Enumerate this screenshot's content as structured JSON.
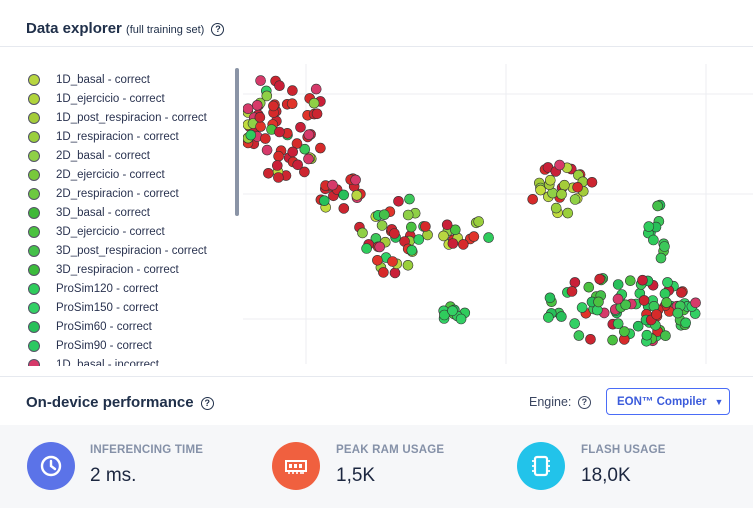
{
  "explorer": {
    "title": "Data explorer",
    "subtitle": "(full training set)",
    "legend": [
      {
        "label": "1D_basal - correct",
        "color": "#b8d641"
      },
      {
        "label": "1D_ejercicio - correct",
        "color": "#b0d43c"
      },
      {
        "label": "1D_post_respiracion - correct",
        "color": "#a4cc3a"
      },
      {
        "label": "1D_respiracion - correct",
        "color": "#9acf3c"
      },
      {
        "label": "2D_basal - correct",
        "color": "#8fd046"
      },
      {
        "label": "2D_ejercicio - correct",
        "color": "#78c83c"
      },
      {
        "label": "2D_respiracion - correct",
        "color": "#6dc840"
      },
      {
        "label": "3D_basal - correct",
        "color": "#3fb838"
      },
      {
        "label": "3D_ejercicio - correct",
        "color": "#4bc240"
      },
      {
        "label": "3D_post_respiracion - correct",
        "color": "#45c04a"
      },
      {
        "label": "3D_respiracion - correct",
        "color": "#3cbb3c"
      },
      {
        "label": "ProSim120 - correct",
        "color": "#2fcc5c"
      },
      {
        "label": "ProSim150 - correct",
        "color": "#33d065"
      },
      {
        "label": "ProSim60 - correct",
        "color": "#27c05a"
      },
      {
        "label": "ProSim90 - correct",
        "color": "#2cc862"
      },
      {
        "label": "1D_basal - incorrect",
        "color": "#d63a6a"
      }
    ]
  },
  "performance": {
    "title": "On-device performance",
    "engine_label": "Engine:",
    "engine_value": "EON™ Compiler",
    "metrics": [
      {
        "label": "INFERENCING TIME",
        "value": "2 ms.",
        "icon": "clock-icon",
        "color": "#5b73e8"
      },
      {
        "label": "PEAK RAM USAGE",
        "value": "1,5K",
        "icon": "ram-icon",
        "color": "#f0603f"
      },
      {
        "label": "FLASH USAGE",
        "value": "18,0K",
        "icon": "chip-icon",
        "color": "#22c3ea"
      }
    ]
  },
  "colors": {
    "correct_dark": "#3cc85a",
    "correct_light": "#b8d641",
    "incorrect": "#d62a2a"
  }
}
